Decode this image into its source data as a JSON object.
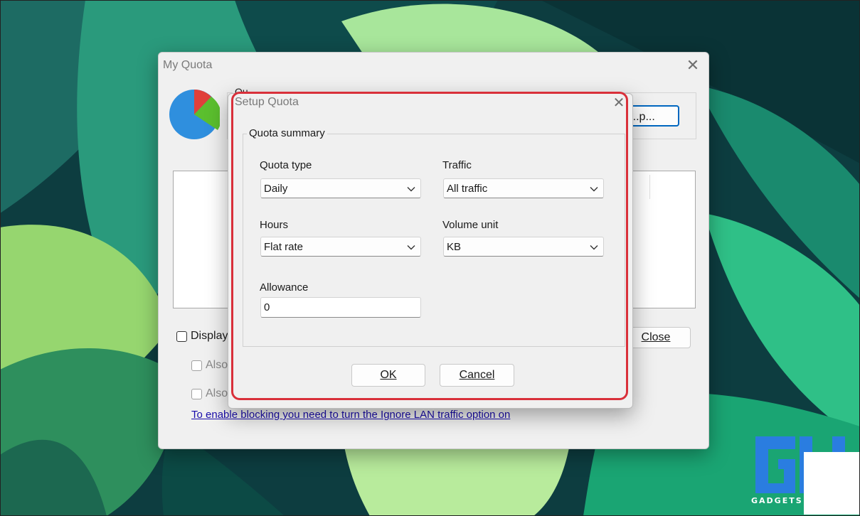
{
  "main_window": {
    "title": "My Quota",
    "group_label": "Qu",
    "setup_button": "...p...",
    "display_checkbox": "Display",
    "also_checkbox_1": "Also",
    "also_checkbox_2": "Also",
    "close_button": "Close",
    "lan_link": "To enable blocking you need to turn the Ignore LAN traffic option on"
  },
  "setup_dialog": {
    "title": "Setup Quota",
    "group_label": "Quota summary",
    "quota_type": {
      "label": "Quota type",
      "value": "Daily"
    },
    "traffic": {
      "label": "Traffic",
      "value": "All traffic"
    },
    "hours": {
      "label": "Hours",
      "value": "Flat rate"
    },
    "volume_unit": {
      "label": "Volume unit",
      "value": "KB"
    },
    "allowance": {
      "label": "Allowance",
      "value": "0"
    },
    "ok_button": "OK",
    "cancel_button": "Cancel"
  },
  "colors": {
    "highlight": "#d9303a",
    "pie_blue": "#2f8fde",
    "pie_green": "#5bbf2e",
    "pie_red": "#e0403a",
    "link": "#1a0dab"
  },
  "icons": [
    "pie-chart-icon",
    "close-icon",
    "chevron-down-icon"
  ]
}
